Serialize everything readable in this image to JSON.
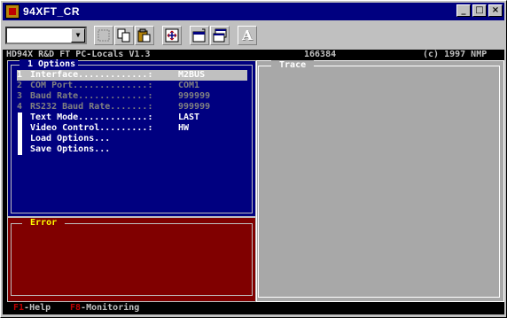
{
  "window": {
    "title": "94XFT_CR",
    "minimize_glyph": "_",
    "maximize_glyph": "□",
    "close_glyph": "×"
  },
  "toolbar": {
    "combo_value": "",
    "combo_arrow": "▼",
    "font_button_label": "A"
  },
  "header": {
    "program": "HD94X R&D FT PC-Locals V1.3",
    "number": "166384",
    "copyright": "(c) 1997 NMP"
  },
  "options": {
    "legend": " 1 Options",
    "items": [
      {
        "num": "1",
        "label": "Interface.............:",
        "value": "M2BUS",
        "state": "selected"
      },
      {
        "num": "2",
        "label": "COM Port..............:",
        "value": "COM1",
        "state": "dim"
      },
      {
        "num": "3",
        "label": "Baud Rate.............:",
        "value": "999999",
        "state": "dim"
      },
      {
        "num": "4",
        "label": "RS232 Baud Rate.......:",
        "value": "999999",
        "state": "dim"
      },
      {
        "num": "",
        "label": "Text Mode.............:",
        "value": "LAST",
        "state": "normal"
      },
      {
        "num": "",
        "label": "Video Control.........:",
        "value": "HW",
        "state": "normal"
      },
      {
        "num": "",
        "label": "Load Options...",
        "value": "",
        "state": "normal"
      },
      {
        "num": "",
        "label": "Save Options...",
        "value": "",
        "state": "normal"
      }
    ]
  },
  "error": {
    "legend": " Error "
  },
  "trace": {
    "legend": " Trace "
  },
  "status": {
    "f1_key": "F1",
    "f1_label": "-Help",
    "f8_key": "F8",
    "f8_label": "-Monitoring"
  },
  "colors": {
    "options_bg": "#000080",
    "error_bg": "#800000",
    "trace_bg": "#a8a8a8"
  }
}
